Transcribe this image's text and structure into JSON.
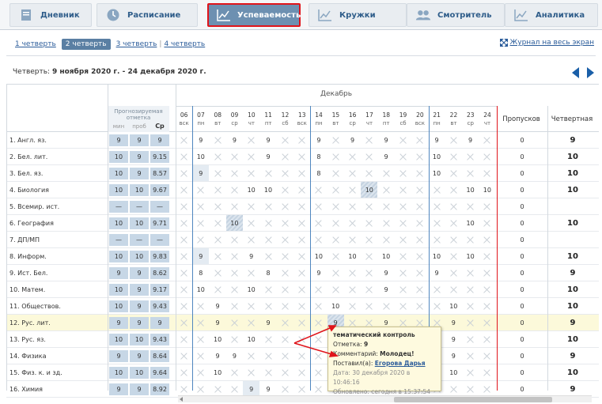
{
  "nav": [
    {
      "label": "Дневник",
      "icon": "book-icon",
      "active": false
    },
    {
      "label": "Расписание",
      "icon": "clock-icon",
      "active": false
    },
    {
      "label": "Успеваемость",
      "icon": "chart-icon",
      "active": true
    },
    {
      "label": "Кружки",
      "icon": "chart-icon",
      "active": false
    },
    {
      "label": "Смотритель",
      "icon": "people-icon",
      "active": false
    },
    {
      "label": "Аналитика",
      "icon": "chart-icon",
      "active": false
    }
  ],
  "quarters": [
    "1 четверть",
    "2 четверть",
    "3 четверть",
    "4 четверть"
  ],
  "active_quarter": 1,
  "fullscreen_label": "Журнал на весь экран",
  "period": {
    "prefix": "Четверть: ",
    "text": "9 ноября 2020 г. - 24 декабря 2020 г."
  },
  "headers": {
    "forecast": "Прогнозируемая отметка",
    "sub": [
      "мин",
      "проб",
      "Ср"
    ],
    "month": "Декабрь",
    "absences": "Пропусков",
    "quarter": "Четвертная"
  },
  "days": [
    {
      "d": "06",
      "w": "вск"
    },
    {
      "d": "07",
      "w": "пн"
    },
    {
      "d": "08",
      "w": "вт"
    },
    {
      "d": "09",
      "w": "ср"
    },
    {
      "d": "10",
      "w": "чт"
    },
    {
      "d": "11",
      "w": "пт"
    },
    {
      "d": "12",
      "w": "сб"
    },
    {
      "d": "13",
      "w": "вск"
    },
    {
      "d": "14",
      "w": "пн"
    },
    {
      "d": "15",
      "w": "вт"
    },
    {
      "d": "16",
      "w": "ср"
    },
    {
      "d": "17",
      "w": "чт"
    },
    {
      "d": "18",
      "w": "пт"
    },
    {
      "d": "19",
      "w": "сб"
    },
    {
      "d": "20",
      "w": "вск"
    },
    {
      "d": "21",
      "w": "пн"
    },
    {
      "d": "22",
      "w": "вт"
    },
    {
      "d": "23",
      "w": "ср"
    },
    {
      "d": "24",
      "w": "чт"
    }
  ],
  "rows": [
    {
      "name": "1. Англ. яз.",
      "f": [
        "9",
        "9",
        "9"
      ],
      "m": [
        "",
        "9",
        "",
        "9",
        "",
        "9",
        "",
        "",
        "9",
        "",
        "9",
        "",
        "9",
        "",
        "",
        "9",
        "",
        "9",
        ""
      ],
      "abs": "0",
      "q": "9"
    },
    {
      "name": "2. Бел. лит.",
      "f": [
        "10",
        "9",
        "9.15"
      ],
      "m": [
        "",
        "10",
        "",
        "",
        "",
        "9",
        "",
        "",
        "8",
        "",
        "",
        "",
        "9",
        "",
        "",
        "10",
        "",
        "",
        ""
      ],
      "abs": "0",
      "q": "10"
    },
    {
      "name": "3. Бел. яз.",
      "f": [
        "10",
        "9",
        "8.57"
      ],
      "m": [
        "",
        "9",
        "",
        "",
        "",
        "",
        "",
        "",
        "8",
        "",
        "",
        "",
        "",
        "",
        "",
        "10",
        "",
        "",
        ""
      ],
      "abs": "0",
      "q": "10"
    },
    {
      "name": "4. Биология",
      "f": [
        "10",
        "10",
        "9.67"
      ],
      "m": [
        "",
        "",
        "",
        "",
        "10",
        "10",
        "",
        "",
        "",
        "",
        "",
        "10",
        "",
        "",
        "",
        "",
        "",
        "10",
        "10"
      ],
      "abs": "0",
      "q": "10"
    },
    {
      "name": "5. Всемир. ист.",
      "f": [
        "—",
        "—",
        "—"
      ],
      "m": [
        "",
        "",
        "",
        "",
        "",
        "",
        "",
        "",
        "",
        "",
        "",
        "",
        "",
        "",
        "",
        "",
        "",
        "",
        ""
      ],
      "abs": "0",
      "q": ""
    },
    {
      "name": "6. География",
      "f": [
        "10",
        "10",
        "9.71"
      ],
      "m": [
        "",
        "",
        "",
        "10",
        "",
        "",
        "",
        "",
        "",
        "",
        "",
        "",
        "",
        "",
        "",
        "",
        "",
        "10",
        ""
      ],
      "abs": "0",
      "q": "10"
    },
    {
      "name": "7. ДП/МП",
      "f": [
        "—",
        "—",
        "—"
      ],
      "m": [
        "",
        "",
        "",
        "",
        "",
        "",
        "",
        "",
        "",
        "",
        "",
        "",
        "",
        "",
        "",
        "",
        "",
        "",
        ""
      ],
      "abs": "0",
      "q": ""
    },
    {
      "name": "8. Информ.",
      "f": [
        "10",
        "10",
        "9.83"
      ],
      "m": [
        "",
        "9",
        "",
        "",
        "9",
        "",
        "",
        "",
        "10",
        "",
        "10",
        "",
        "10",
        "",
        "",
        "10",
        "",
        "10",
        ""
      ],
      "abs": "0",
      "q": "10"
    },
    {
      "name": "9. Ист. Бел.",
      "f": [
        "9",
        "9",
        "8.62"
      ],
      "m": [
        "",
        "8",
        "",
        "",
        "",
        "8",
        "",
        "",
        "9",
        "",
        "",
        "",
        "9",
        "",
        "",
        "9",
        "",
        "",
        ""
      ],
      "abs": "0",
      "q": "9"
    },
    {
      "name": "10. Матем.",
      "f": [
        "10",
        "9",
        "9.17"
      ],
      "m": [
        "",
        "10",
        "",
        "",
        "10",
        "",
        "",
        "",
        "",
        "",
        "",
        "",
        "9",
        "",
        "",
        "",
        "",
        "",
        ""
      ],
      "abs": "0",
      "q": "10"
    },
    {
      "name": "11. Обществов.",
      "f": [
        "10",
        "9",
        "9.43"
      ],
      "m": [
        "",
        "",
        "9",
        "",
        "",
        "",
        "",
        "",
        "",
        "10",
        "",
        "",
        "",
        "",
        "",
        "",
        "10",
        "",
        ""
      ],
      "abs": "0",
      "q": "10"
    },
    {
      "name": "12. Рус. лит.",
      "f": [
        "9",
        "9",
        "9"
      ],
      "m": [
        "",
        "",
        "9",
        "",
        "",
        "9",
        "",
        "",
        "",
        "9",
        "",
        "",
        "9",
        "",
        "",
        "",
        "9",
        "",
        ""
      ],
      "abs": "0",
      "q": "9"
    },
    {
      "name": "13. Рус. яз.",
      "f": [
        "10",
        "10",
        "9.43"
      ],
      "m": [
        "",
        "",
        "10",
        "",
        "10",
        "",
        "",
        "",
        "",
        "",
        "",
        "",
        "",
        "",
        "",
        "",
        "9",
        "",
        ""
      ],
      "abs": "0",
      "q": "10"
    },
    {
      "name": "14. Физика",
      "f": [
        "9",
        "9",
        "8.64"
      ],
      "m": [
        "",
        "",
        "9",
        "9",
        "",
        "",
        "",
        "",
        "",
        "",
        "",
        "",
        "",
        "",
        "",
        "",
        "9",
        "",
        ""
      ],
      "abs": "0",
      "q": "9"
    },
    {
      "name": "15. Физ. к. и зд.",
      "f": [
        "10",
        "10",
        "9.64"
      ],
      "m": [
        "",
        "",
        "10",
        "",
        "",
        "",
        "",
        "",
        "",
        "",
        "",
        "",
        "",
        "",
        "",
        "",
        "10",
        "",
        ""
      ],
      "abs": "0",
      "q": "10"
    },
    {
      "name": "16. Химия",
      "f": [
        "9",
        "9",
        "8.92"
      ],
      "m": [
        "",
        "",
        "",
        "",
        "9",
        "9",
        "",
        "",
        "",
        "",
        "",
        "",
        "",
        "",
        "",
        "",
        "",
        "",
        ""
      ],
      "abs": "0",
      "q": "9"
    }
  ],
  "tooltip": {
    "title": "тематический контроль",
    "grade_label": "Отметка: ",
    "grade": "9",
    "comment_label": "Комментарий: ",
    "comment": "Молодец!",
    "author_label": "Поставил(а): ",
    "author": "Егорова Дарья",
    "date": "Дата: 30 декабря 2020 в 10:46:16",
    "updated": "Обновлено: сегодня в 15:37:54"
  },
  "colors": {
    "accent": "#6d90b1",
    "highlight_row": "#fcf9da",
    "red": "#e0141b",
    "link": "#2b5c9a"
  }
}
